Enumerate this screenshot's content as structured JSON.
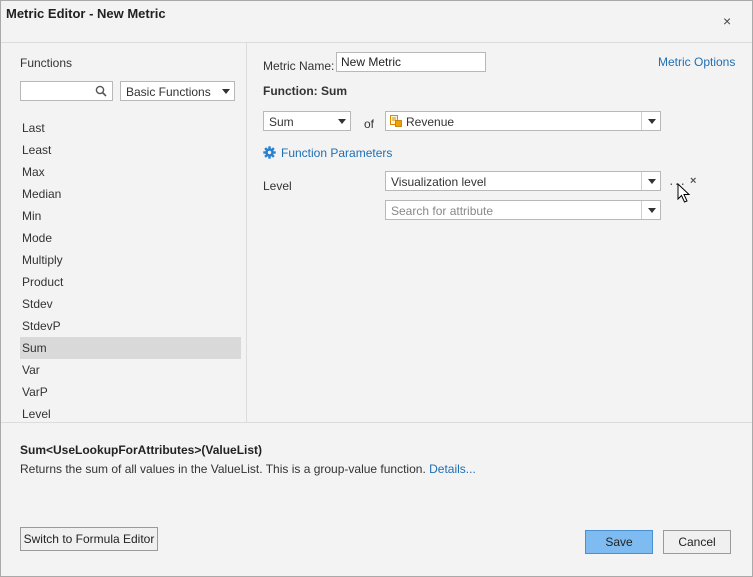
{
  "dialog": {
    "title": "Metric Editor - New Metric",
    "close_glyph": "×"
  },
  "left": {
    "functions_label": "Functions",
    "search_value": "",
    "category": "Basic Functions",
    "items": [
      {
        "label": "Last"
      },
      {
        "label": "Least"
      },
      {
        "label": "Max"
      },
      {
        "label": "Median"
      },
      {
        "label": "Min"
      },
      {
        "label": "Mode"
      },
      {
        "label": "Multiply"
      },
      {
        "label": "Product"
      },
      {
        "label": "Stdev"
      },
      {
        "label": "StdevP"
      },
      {
        "label": "Sum",
        "selected": true
      },
      {
        "label": "Var"
      },
      {
        "label": "VarP"
      },
      {
        "label": "Level"
      }
    ]
  },
  "right": {
    "metric_name_label": "Metric Name:",
    "metric_name_value": "New Metric",
    "metric_options": "Metric Options",
    "function_heading": "Function: Sum",
    "function_value": "Sum",
    "of_label": "of",
    "operand_value": "Revenue",
    "function_parameters": "Function Parameters",
    "level_label": "Level",
    "level_value": "Visualization level",
    "attribute_search_placeholder": "Search for attribute",
    "more_glyph": "···",
    "remove_glyph": "×"
  },
  "footer": {
    "signature": "Sum<UseLookupForAttributes>(ValueList)",
    "description": "Returns the sum of all values in the ValueList. This is a group-value function.",
    "details_link": "Details...",
    "switch_button": "Switch to Formula Editor",
    "save_button": "Save",
    "cancel_button": "Cancel"
  },
  "icons": {
    "search": "search-icon",
    "close": "close-icon",
    "gear": "gear-icon",
    "metric": "metric-icon",
    "dropdown": "chevron-down-icon"
  },
  "colors": {
    "accent_link": "#1e6fb4",
    "primary_button": "#7ebbf0",
    "selected_row": "#d9d9d9",
    "gear": "#2a7fcf"
  }
}
